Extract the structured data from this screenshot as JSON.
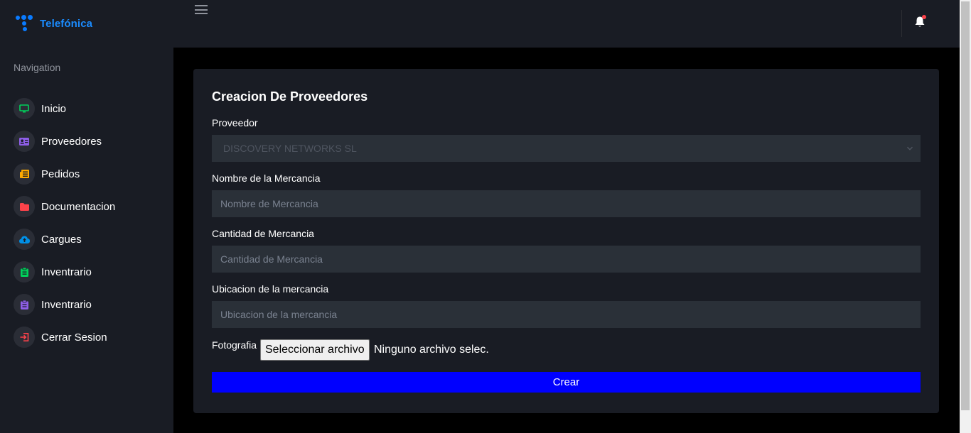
{
  "brand": {
    "name": "Telefónica",
    "color": "#0a7bff"
  },
  "sidebar": {
    "title": "Navigation",
    "items": [
      {
        "label": "Inicio",
        "icon": "monitor-icon",
        "color": "#00d25b"
      },
      {
        "label": "Proveedores",
        "icon": "id-card-icon",
        "color": "#8f5fe8"
      },
      {
        "label": "Pedidos",
        "icon": "newspaper-icon",
        "color": "#ffab00"
      },
      {
        "label": "Documentacion",
        "icon": "folder-icon",
        "color": "#fc424a"
      },
      {
        "label": "Cargues",
        "icon": "cloud-upload-icon",
        "color": "#0090e7"
      },
      {
        "label": "Inventrario",
        "icon": "clipboard-icon",
        "color": "#00d25b"
      },
      {
        "label": "Inventrario",
        "icon": "clipboard-icon",
        "color": "#8f5fe8"
      },
      {
        "label": "Cerrar Sesion",
        "icon": "logout-icon",
        "color": "#fc424a"
      }
    ]
  },
  "form": {
    "title": "Creacion De Proveedores",
    "proveedor": {
      "label": "Proveedor",
      "value": "DISCOVERY NETWORKS SL"
    },
    "nombre": {
      "label": "Nombre de la Mercancia",
      "placeholder": "Nombre de Mercancia"
    },
    "cantidad": {
      "label": "Cantidad de Mercancia",
      "placeholder": "Cantidad de Mercancia"
    },
    "ubicacion": {
      "label": "Ubicacion de la mercancia",
      "placeholder": "Ubicacion de la mercancia"
    },
    "foto": {
      "label": "Fotografia",
      "button": "Seleccionar archivo",
      "status": "Ninguno archivo selec."
    },
    "submit": "Crear"
  }
}
